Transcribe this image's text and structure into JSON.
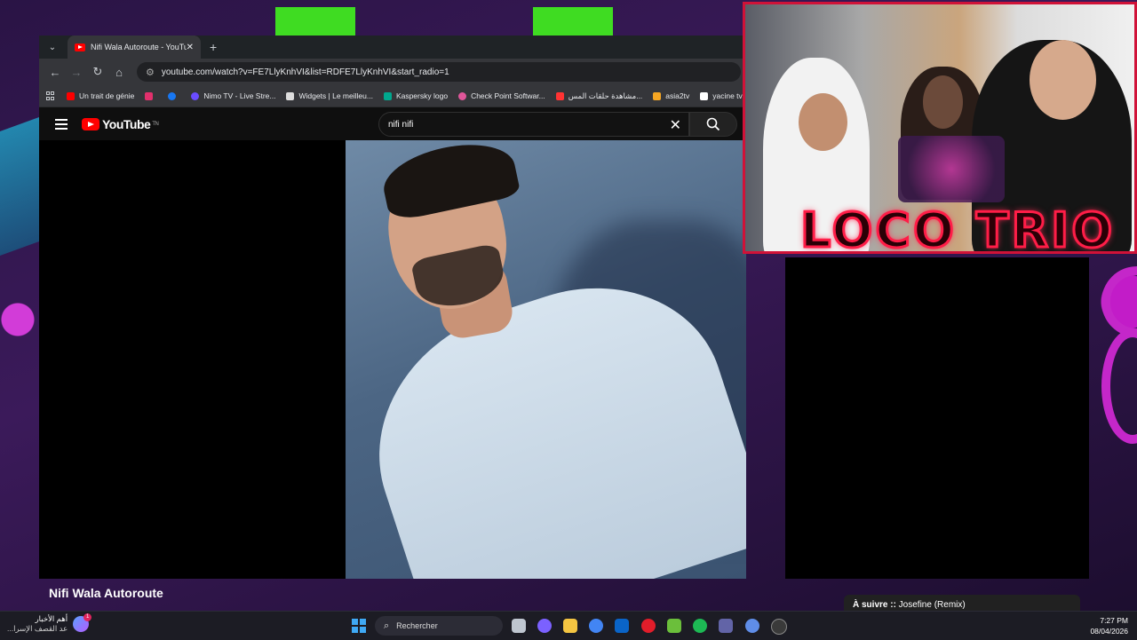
{
  "browser": {
    "tab_title": "Nifi Wala Autoroute - YouTube",
    "tab_close": "✕",
    "new_tab": "+",
    "url": "youtube.com/watch?v=FE7LlyKnhVI&list=RDFE7LlyKnhVI&start_radio=1",
    "bookmarks": [
      {
        "label": "Un trait de génie",
        "color": "#ff0000"
      },
      {
        "label": "",
        "color": "#e1306c"
      },
      {
        "label": "",
        "color": "#1877f2"
      },
      {
        "label": "Nimo TV - Live Stre...",
        "color": "#6a4cff"
      },
      {
        "label": "Widgets | Le meilleu...",
        "color": "#dddddd"
      },
      {
        "label": "Kaspersky logo",
        "color": "#00a88e"
      },
      {
        "label": "Check Point Softwar...",
        "color": "#e0569a"
      },
      {
        "label": "مشاهدة حلقات المس...",
        "color": "#ff3333"
      },
      {
        "label": "asia2tv",
        "color": "#f5a623"
      },
      {
        "label": "yacine tv - ياسين تي...",
        "color": "#ffffff"
      }
    ]
  },
  "youtube": {
    "logo_text": "YouTube",
    "country": "TN",
    "search_value": "nifi nifi",
    "clear_icon": "✕",
    "video_title": "Nifi Wala Autoroute",
    "up_next_label": "À suivre ::",
    "up_next_title": " Josefine (Remix)"
  },
  "overlay": {
    "brand": "LOCO TRIO",
    "border_color": "#d01238"
  },
  "taskbar": {
    "news_title": "أهم الأخبار",
    "news_sub": "عد القصف الإسرا...",
    "news_badge": "1",
    "search_placeholder": "Rechercher",
    "time": "7:27 PM",
    "date": "08/04/2026",
    "app_icons": [
      {
        "name": "task-view-icon",
        "color": "#bfc6d0"
      },
      {
        "name": "copilot-icon",
        "color": "#7b61ff"
      },
      {
        "name": "file-explorer-icon",
        "color": "#f4c542"
      },
      {
        "name": "chrome-icon",
        "color": "#4285f4"
      },
      {
        "name": "outlook-icon",
        "color": "#0a64c8"
      },
      {
        "name": "opera-icon",
        "color": "#e11d2a"
      },
      {
        "name": "bluestacks-icon",
        "color": "#6bbf3b"
      },
      {
        "name": "spotify-icon",
        "color": "#1db954"
      },
      {
        "name": "teams-icon",
        "color": "#6264a7"
      },
      {
        "name": "chrome-active-icon",
        "color": "#5f8de8"
      },
      {
        "name": "obs-icon",
        "color": "#3a3a3a"
      }
    ]
  }
}
